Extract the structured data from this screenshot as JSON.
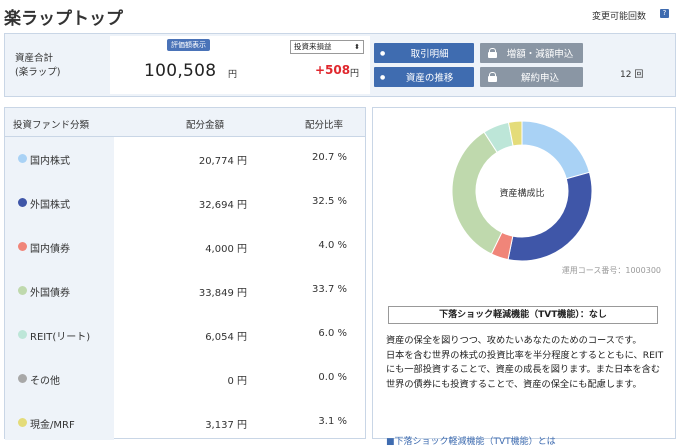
{
  "page": {
    "title": "楽ラップトップ"
  },
  "summary": {
    "label": "資産合計\n(楽ラップ)",
    "eval_badge": "評価額表示",
    "amount": "100,508",
    "amount_unit": "円",
    "select_value": "投資来損益",
    "gain": "+508",
    "gain_unit": "円"
  },
  "buttons": {
    "transactions": "取引明細",
    "asset_history": "資産の推移",
    "increase_decrease": "増額・減額申込",
    "cancel": "解約申込"
  },
  "change": {
    "label": "変更可能回数",
    "help": "?",
    "count": "12 回"
  },
  "table": {
    "headers": [
      "投資ファンド分類",
      "配分金額",
      "配分比率"
    ],
    "rows": [
      {
        "category": "国内株式",
        "amount": "20,774 円",
        "ratio": "20.7 %",
        "color": "#a9d2f5"
      },
      {
        "category": "外国株式",
        "amount": "32,694 円",
        "ratio": "32.5 %",
        "color": "#3f56a8"
      },
      {
        "category": "国内債券",
        "amount": "4,000 円",
        "ratio": "4.0 %",
        "color": "#f08579"
      },
      {
        "category": "外国債券",
        "amount": "33,849 円",
        "ratio": "33.7 %",
        "color": "#bfd9ad"
      },
      {
        "category": "REIT(リート)",
        "amount": "6,054 円",
        "ratio": "6.0 %",
        "color": "#bde6d8"
      },
      {
        "category": "その他",
        "amount": "0 円",
        "ratio": "0.0 %",
        "color": "#a8a8a8"
      },
      {
        "category": "現金/MRF",
        "amount": "3,137 円",
        "ratio": "3.1 %",
        "color": "#e4dc7a"
      }
    ]
  },
  "chart_data": {
    "type": "pie",
    "title": "資産構成比",
    "categories": [
      "国内株式",
      "外国株式",
      "国内債券",
      "外国債券",
      "REIT(リート)",
      "その他",
      "現金/MRF"
    ],
    "values": [
      20.7,
      32.5,
      4.0,
      33.7,
      6.0,
      0.0,
      3.1
    ],
    "colors": [
      "#a9d2f5",
      "#3f56a8",
      "#f08579",
      "#bfd9ad",
      "#bde6d8",
      "#a8a8a8",
      "#e4dc7a"
    ]
  },
  "course": "運用コース番号：1000300",
  "tvt": "下落ショック軽減機能（TVT機能）：なし",
  "description": "資産の保全を図りつつ、攻めたいあなたのためのコースです。\n日本を含む世界の株式の投資比率を半分程度とするとともに、REITにも一部投資することで、資産の成長を図ります。また日本を含む世界の債券にも投資することで、資産の保全にも配慮します。",
  "cutoff_text": "■下落ショック軽減機能（TVT機能）とは"
}
